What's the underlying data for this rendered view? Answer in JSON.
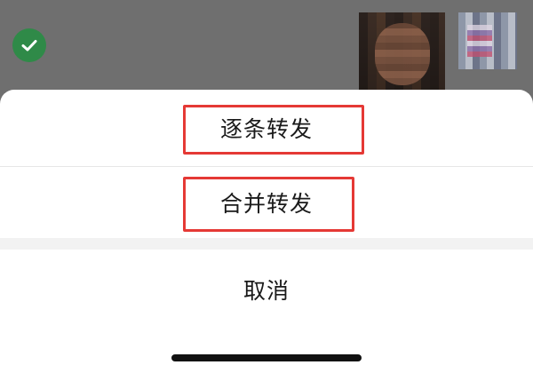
{
  "sheet": {
    "options": [
      {
        "label": "逐条转发"
      },
      {
        "label": "合并转发"
      }
    ],
    "cancel_label": "取消"
  },
  "background": {
    "selection_icon": "check-circle-icon",
    "selection_color": "#2f8a48"
  },
  "annotation": {
    "highlight_color": "#e53935"
  }
}
